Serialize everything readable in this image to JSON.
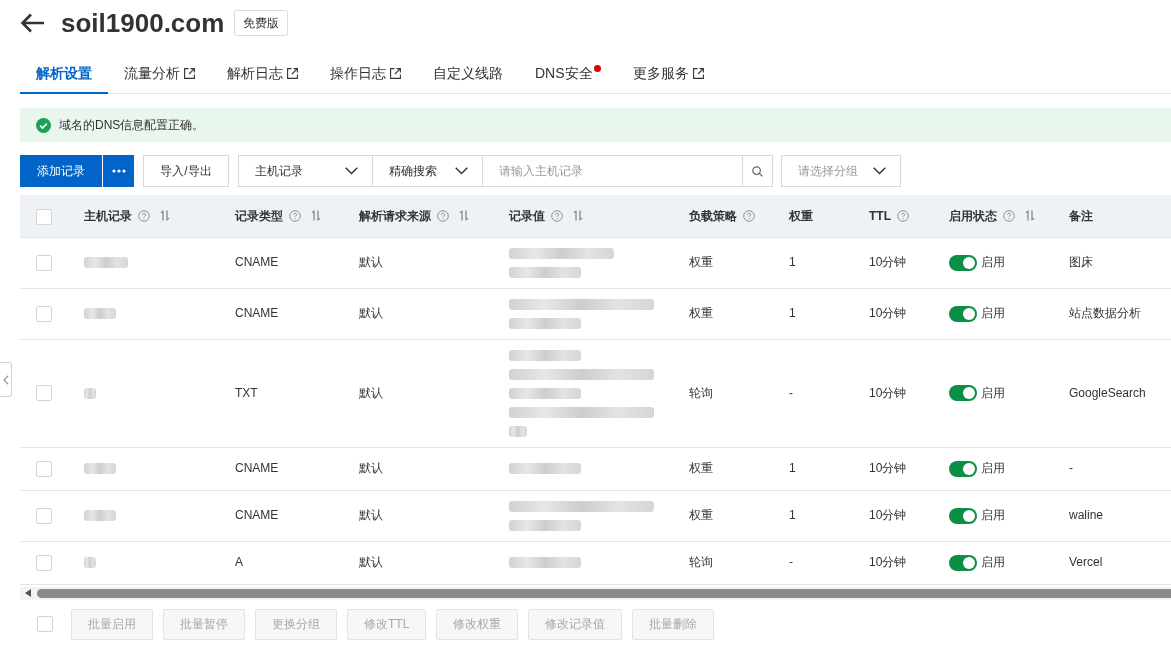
{
  "header": {
    "title": "soil1900.com",
    "badge": "免费版"
  },
  "tabs": [
    {
      "label": "解析设置",
      "selected": true,
      "external": false,
      "dot": false
    },
    {
      "label": "流量分析",
      "selected": false,
      "external": true,
      "dot": false
    },
    {
      "label": "解析日志",
      "selected": false,
      "external": true,
      "dot": false
    },
    {
      "label": "操作日志",
      "selected": false,
      "external": true,
      "dot": false
    },
    {
      "label": "自定义线路",
      "selected": false,
      "external": false,
      "dot": false
    },
    {
      "label": "DNS安全",
      "selected": false,
      "external": false,
      "dot": true
    },
    {
      "label": "更多服务",
      "selected": false,
      "external": true,
      "dot": false
    }
  ],
  "alert": {
    "kind": "success",
    "text": "域名的DNS信息配置正确。"
  },
  "toolbar": {
    "add_button": "添加记录",
    "import_export_button": "导入/导出",
    "field_select": {
      "value": "主机记录"
    },
    "match_select": {
      "value": "精确搜索"
    },
    "search": {
      "placeholder": "请输入主机记录"
    },
    "group_select": {
      "placeholder": "请选择分组"
    }
  },
  "table": {
    "select_all": {
      "checked": false
    },
    "columns": [
      {
        "label": "主机记录",
        "help": true,
        "sortable": true
      },
      {
        "label": "记录类型",
        "help": true,
        "sortable": true
      },
      {
        "label": "解析请求来源",
        "help": true,
        "sortable": true
      },
      {
        "label": "记录值",
        "help": true,
        "sortable": true
      },
      {
        "label": "负载策略",
        "help": true,
        "sortable": false
      },
      {
        "label": "权重",
        "help": false,
        "sortable": false
      },
      {
        "label": "TTL",
        "help": true,
        "sortable": false
      },
      {
        "label": "启用状态",
        "help": true,
        "sortable": true
      },
      {
        "label": "备注",
        "help": false,
        "sortable": false
      }
    ],
    "rows": [
      {
        "selected": false,
        "host": {
          "kind": "long"
        },
        "type": "CNAME",
        "source": "默认",
        "value": {
          "lines": [
            {
              "kind": "medium"
            },
            {
              "kind": "short"
            }
          ]
        },
        "policy": "权重",
        "weight": "1",
        "ttl": "10分钟",
        "enabled": true,
        "status": "启用",
        "note": "图床"
      },
      {
        "selected": false,
        "host": {
          "kind": "medium"
        },
        "type": "CNAME",
        "source": "默认",
        "value": {
          "lines": [
            {
              "kind": "long"
            },
            {
              "kind": "short"
            }
          ]
        },
        "policy": "权重",
        "weight": "1",
        "ttl": "10分钟",
        "enabled": true,
        "status": "启用",
        "note": "站点数据分析"
      },
      {
        "selected": false,
        "host": {
          "kind": "short"
        },
        "type": "TXT",
        "source": "默认",
        "value": {
          "lines": [
            {
              "kind": "short"
            },
            {
              "kind": "long"
            },
            {
              "kind": "short"
            },
            {
              "kind": "long"
            },
            {
              "kind": "tiny"
            }
          ]
        },
        "policy": "轮询",
        "weight": "-",
        "ttl": "10分钟",
        "enabled": true,
        "status": "启用",
        "note": "GoogleSearch"
      },
      {
        "selected": false,
        "host": {
          "kind": "medium"
        },
        "type": "CNAME",
        "source": "默认",
        "value": {
          "lines": [
            {
              "kind": "short"
            }
          ]
        },
        "policy": "权重",
        "weight": "1",
        "ttl": "10分钟",
        "enabled": true,
        "status": "启用",
        "note": "-"
      },
      {
        "selected": false,
        "host": {
          "kind": "medium"
        },
        "type": "CNAME",
        "source": "默认",
        "value": {
          "lines": [
            {
              "kind": "long"
            },
            {
              "kind": "short"
            }
          ]
        },
        "policy": "权重",
        "weight": "1",
        "ttl": "10分钟",
        "enabled": true,
        "status": "启用",
        "note": "waline"
      },
      {
        "selected": false,
        "host": {
          "kind": "short"
        },
        "type": "A",
        "source": "默认",
        "value": {
          "lines": [
            {
              "kind": "short"
            }
          ]
        },
        "policy": "轮询",
        "weight": "-",
        "ttl": "10分钟",
        "enabled": true,
        "status": "启用",
        "note": "Vercel"
      }
    ]
  },
  "bulk_actions": {
    "select_all": {
      "checked": false
    },
    "buttons": [
      {
        "label": "批量启用",
        "disabled": true
      },
      {
        "label": "批量暂停",
        "disabled": true
      },
      {
        "label": "更换分组",
        "disabled": true
      },
      {
        "label": "修改TTL",
        "disabled": true
      },
      {
        "label": "修改权重",
        "disabled": true
      },
      {
        "label": "修改记录值",
        "disabled": true
      },
      {
        "label": "批量删除",
        "disabled": true
      }
    ]
  }
}
